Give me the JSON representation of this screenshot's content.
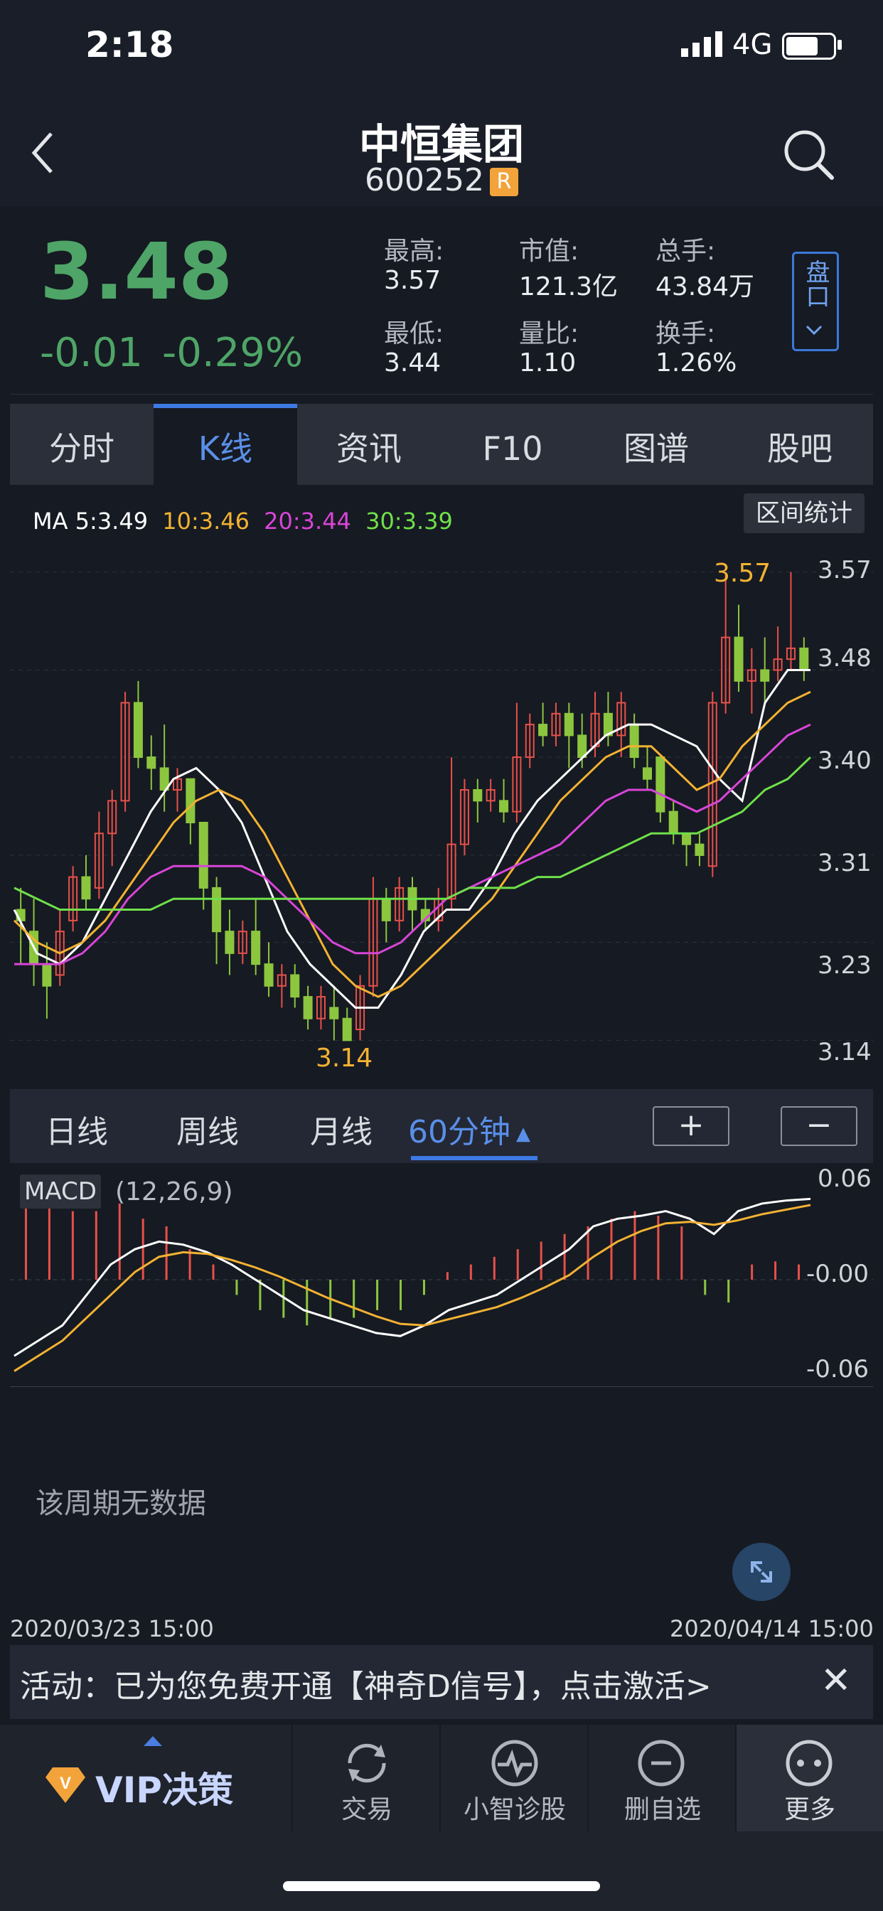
{
  "status": {
    "time": "2:18",
    "network": "4G"
  },
  "header": {
    "title": "中恒集团",
    "code": "600252",
    "badge": "R"
  },
  "quote": {
    "price": "3.48",
    "change": "-0.01",
    "change_pct": "-0.29%",
    "stats": [
      {
        "label": "最高:",
        "value": "3.57"
      },
      {
        "label": "市值:",
        "value": "121.3亿"
      },
      {
        "label": "总手:",
        "value": "43.84万"
      },
      {
        "label": "最低:",
        "value": "3.44"
      },
      {
        "label": "量比:",
        "value": "1.10"
      },
      {
        "label": "换手:",
        "value": "1.26%"
      }
    ],
    "pankou": "盘口"
  },
  "tabs": [
    "分时",
    "K线",
    "资讯",
    "F10",
    "图谱",
    "股吧"
  ],
  "active_tab": "K线",
  "chart": {
    "ma_prefix": "MA 5:3.49",
    "ma10": "10:3.46",
    "ma20": "20:3.44",
    "ma30": "30:3.39",
    "interval_button": "区间统计",
    "high_label": "3.57",
    "low_label": "3.14",
    "yticks": [
      "3.57",
      "3.48",
      "3.40",
      "3.31",
      "3.23",
      "3.14"
    ],
    "colors": {
      "up": "#e8504a",
      "down": "#8cc63f",
      "ma5": "#ffffff",
      "ma10": "#f2b233",
      "ma20": "#d845d8",
      "ma30": "#6fe04a"
    }
  },
  "periods": {
    "items": [
      "日线",
      "周线",
      "月线",
      "60分钟"
    ],
    "active": "60分钟",
    "zoom_in": "+",
    "zoom_out": "−"
  },
  "macd": {
    "label": "MACD",
    "params": "(12,26,9)",
    "yticks": [
      "0.06",
      "-0.00",
      "-0.06"
    ],
    "nodata": "该周期无数据"
  },
  "dates": {
    "start": "2020/03/23 15:00",
    "end": "2020/04/14 15:00"
  },
  "banner": {
    "text": "活动：已为您免费开通【神奇D信号】，点击激活>",
    "close": "✕"
  },
  "bottom_nav": {
    "vip": "VIP决策",
    "items": [
      "交易",
      "小智诊股",
      "删自选",
      "更多"
    ]
  },
  "chart_data": {
    "type": "candlestick",
    "y_range": [
      3.12,
      3.59
    ],
    "high": 3.57,
    "low": 3.14,
    "candles": [
      [
        3.26,
        3.25,
        3.28,
        3.21
      ],
      [
        3.24,
        3.21,
        3.27,
        3.19
      ],
      [
        3.21,
        3.19,
        3.23,
        3.16
      ],
      [
        3.2,
        3.24,
        3.26,
        3.19
      ],
      [
        3.25,
        3.29,
        3.3,
        3.24
      ],
      [
        3.29,
        3.27,
        3.31,
        3.26
      ],
      [
        3.28,
        3.33,
        3.35,
        3.27
      ],
      [
        3.33,
        3.36,
        3.37,
        3.3
      ],
      [
        3.36,
        3.45,
        3.46,
        3.35
      ],
      [
        3.45,
        3.4,
        3.47,
        3.39
      ],
      [
        3.4,
        3.39,
        3.42,
        3.37
      ],
      [
        3.39,
        3.37,
        3.43,
        3.35
      ],
      [
        3.37,
        3.38,
        3.39,
        3.35
      ],
      [
        3.38,
        3.34,
        3.38,
        3.32
      ],
      [
        3.34,
        3.28,
        3.34,
        3.26
      ],
      [
        3.28,
        3.24,
        3.29,
        3.21
      ],
      [
        3.24,
        3.22,
        3.26,
        3.2
      ],
      [
        3.22,
        3.24,
        3.25,
        3.21
      ],
      [
        3.24,
        3.21,
        3.27,
        3.2
      ],
      [
        3.21,
        3.19,
        3.23,
        3.18
      ],
      [
        3.19,
        3.2,
        3.21,
        3.17
      ],
      [
        3.2,
        3.18,
        3.21,
        3.17
      ],
      [
        3.18,
        3.16,
        3.19,
        3.15
      ],
      [
        3.16,
        3.18,
        3.19,
        3.15
      ],
      [
        3.17,
        3.16,
        3.19,
        3.14
      ],
      [
        3.16,
        3.14,
        3.17,
        3.14
      ],
      [
        3.15,
        3.19,
        3.2,
        3.14
      ],
      [
        3.19,
        3.27,
        3.29,
        3.18
      ],
      [
        3.27,
        3.25,
        3.28,
        3.23
      ],
      [
        3.25,
        3.28,
        3.29,
        3.24
      ],
      [
        3.28,
        3.26,
        3.29,
        3.24
      ],
      [
        3.26,
        3.25,
        3.27,
        3.24
      ],
      [
        3.25,
        3.27,
        3.28,
        3.24
      ],
      [
        3.27,
        3.32,
        3.4,
        3.26
      ],
      [
        3.32,
        3.37,
        3.38,
        3.31
      ],
      [
        3.37,
        3.36,
        3.38,
        3.34
      ],
      [
        3.36,
        3.37,
        3.38,
        3.35
      ],
      [
        3.36,
        3.35,
        3.38,
        3.34
      ],
      [
        3.35,
        3.4,
        3.45,
        3.34
      ],
      [
        3.4,
        3.43,
        3.44,
        3.39
      ],
      [
        3.43,
        3.42,
        3.45,
        3.41
      ],
      [
        3.42,
        3.44,
        3.45,
        3.41
      ],
      [
        3.44,
        3.42,
        3.45,
        3.39
      ],
      [
        3.42,
        3.4,
        3.44,
        3.39
      ],
      [
        3.41,
        3.44,
        3.46,
        3.4
      ],
      [
        3.44,
        3.42,
        3.46,
        3.41
      ],
      [
        3.42,
        3.45,
        3.46,
        3.4
      ],
      [
        3.43,
        3.4,
        3.44,
        3.39
      ],
      [
        3.39,
        3.38,
        3.41,
        3.37
      ],
      [
        3.4,
        3.35,
        3.4,
        3.34
      ],
      [
        3.35,
        3.33,
        3.36,
        3.32
      ],
      [
        3.33,
        3.32,
        3.33,
        3.3
      ],
      [
        3.32,
        3.31,
        3.33,
        3.3
      ],
      [
        3.3,
        3.45,
        3.46,
        3.29
      ],
      [
        3.45,
        3.51,
        3.57,
        3.44
      ],
      [
        3.51,
        3.47,
        3.54,
        3.46
      ],
      [
        3.47,
        3.48,
        3.5,
        3.44
      ],
      [
        3.48,
        3.47,
        3.51,
        3.45
      ],
      [
        3.48,
        3.49,
        3.52,
        3.47
      ],
      [
        3.49,
        3.5,
        3.57,
        3.48
      ],
      [
        3.5,
        3.48,
        3.51,
        3.47
      ]
    ],
    "ma": {
      "ma5": [
        3.26,
        3.22,
        3.21,
        3.23,
        3.27,
        3.31,
        3.35,
        3.38,
        3.39,
        3.37,
        3.34,
        3.29,
        3.24,
        3.21,
        3.19,
        3.17,
        3.17,
        3.2,
        3.24,
        3.26,
        3.26,
        3.29,
        3.33,
        3.36,
        3.38,
        3.4,
        3.42,
        3.43,
        3.43,
        3.42,
        3.41,
        3.38,
        3.36,
        3.45,
        3.48,
        3.48
      ],
      "ma10": [
        3.25,
        3.23,
        3.22,
        3.23,
        3.25,
        3.28,
        3.31,
        3.34,
        3.36,
        3.37,
        3.36,
        3.33,
        3.29,
        3.25,
        3.21,
        3.19,
        3.18,
        3.19,
        3.21,
        3.23,
        3.25,
        3.27,
        3.3,
        3.33,
        3.36,
        3.38,
        3.4,
        3.41,
        3.41,
        3.39,
        3.37,
        3.38,
        3.41,
        3.43,
        3.45,
        3.46
      ],
      "ma20": [
        3.21,
        3.21,
        3.21,
        3.22,
        3.24,
        3.27,
        3.29,
        3.3,
        3.3,
        3.3,
        3.3,
        3.29,
        3.27,
        3.25,
        3.23,
        3.22,
        3.22,
        3.23,
        3.25,
        3.27,
        3.28,
        3.29,
        3.3,
        3.31,
        3.32,
        3.34,
        3.36,
        3.37,
        3.37,
        3.36,
        3.35,
        3.36,
        3.38,
        3.4,
        3.42,
        3.43
      ],
      "ma30": [
        3.28,
        3.27,
        3.26,
        3.26,
        3.26,
        3.26,
        3.26,
        3.27,
        3.27,
        3.27,
        3.27,
        3.27,
        3.27,
        3.27,
        3.27,
        3.27,
        3.27,
        3.27,
        3.27,
        3.27,
        3.28,
        3.28,
        3.28,
        3.29,
        3.29,
        3.3,
        3.31,
        3.32,
        3.33,
        3.33,
        3.33,
        3.34,
        3.35,
        3.37,
        3.38,
        3.4
      ]
    },
    "macd": {
      "y_range": [
        -0.07,
        0.07
      ],
      "dif": [
        -0.05,
        -0.04,
        -0.03,
        -0.01,
        0.01,
        0.02,
        0.025,
        0.023,
        0.018,
        0.01,
        0.0,
        -0.01,
        -0.02,
        -0.025,
        -0.03,
        -0.035,
        -0.037,
        -0.03,
        -0.02,
        -0.015,
        -0.01,
        0.0,
        0.01,
        0.02,
        0.035,
        0.04,
        0.042,
        0.045,
        0.04,
        0.03,
        0.045,
        0.05,
        0.052,
        0.053
      ],
      "dea": [
        -0.06,
        -0.05,
        -0.04,
        -0.025,
        -0.01,
        0.005,
        0.015,
        0.018,
        0.017,
        0.013,
        0.008,
        0.002,
        -0.005,
        -0.012,
        -0.018,
        -0.024,
        -0.029,
        -0.03,
        -0.026,
        -0.022,
        -0.018,
        -0.012,
        -0.005,
        0.003,
        0.015,
        0.025,
        0.032,
        0.037,
        0.038,
        0.036,
        0.039,
        0.043,
        0.046,
        0.049
      ],
      "hist": [
        0.055,
        0.05,
        0.045,
        0.045,
        0.05,
        0.04,
        0.035,
        0.02,
        0.01,
        -0.01,
        -0.02,
        -0.025,
        -0.03,
        -0.025,
        -0.025,
        -0.02,
        -0.02,
        -0.01,
        0.005,
        0.01,
        0.015,
        0.02,
        0.025,
        0.03,
        0.035,
        0.04,
        0.045,
        0.042,
        0.035,
        -0.01,
        -0.015,
        0.01,
        0.012,
        0.01
      ]
    }
  }
}
